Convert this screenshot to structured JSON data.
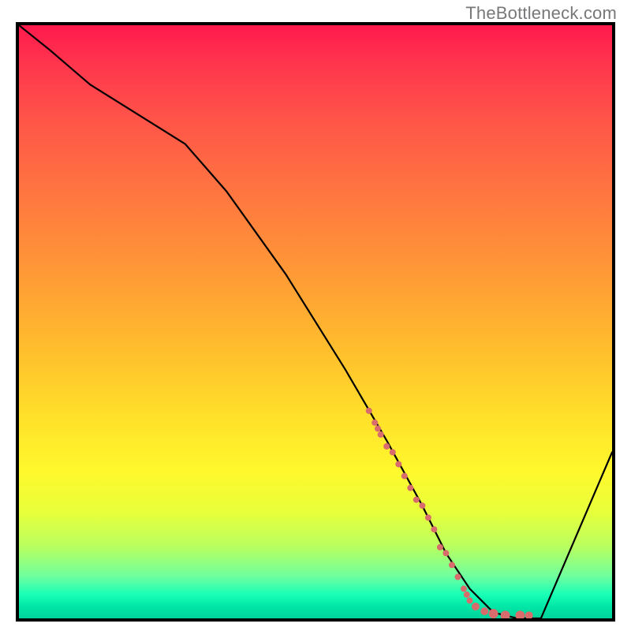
{
  "watermark": "TheBottleneck.com",
  "chart_data": {
    "type": "line",
    "title": "",
    "xlabel": "",
    "ylabel": "",
    "xlim": [
      0,
      100
    ],
    "ylim": [
      0,
      100
    ],
    "gradient_stops": [
      {
        "pos": 0,
        "color": "#ff1a4d"
      },
      {
        "pos": 8,
        "color": "#ff3b4d"
      },
      {
        "pos": 18,
        "color": "#ff5a47"
      },
      {
        "pos": 30,
        "color": "#ff7a3f"
      },
      {
        "pos": 42,
        "color": "#ff9a36"
      },
      {
        "pos": 55,
        "color": "#ffbf2d"
      },
      {
        "pos": 66,
        "color": "#ffe02a"
      },
      {
        "pos": 75,
        "color": "#fff82c"
      },
      {
        "pos": 82,
        "color": "#e8ff3a"
      },
      {
        "pos": 88,
        "color": "#b8ff60"
      },
      {
        "pos": 93,
        "color": "#6dffa0"
      },
      {
        "pos": 96,
        "color": "#18ffb6"
      },
      {
        "pos": 98,
        "color": "#00e7a7"
      },
      {
        "pos": 100,
        "color": "#00d29b"
      }
    ],
    "series": [
      {
        "name": "bottleneck-curve",
        "stroke": "#000000",
        "x": [
          0,
          5,
          12,
          20,
          28,
          35,
          45,
          55,
          62,
          68,
          72,
          76,
          80,
          84,
          88,
          100
        ],
        "values": [
          100,
          96,
          90,
          85,
          80,
          72,
          58,
          42,
          30,
          19,
          11,
          5,
          1,
          0,
          0,
          28
        ]
      }
    ],
    "markers": {
      "name": "highlight-cluster",
      "color": "#d86b6b",
      "x": [
        59,
        60,
        60.5,
        61,
        62,
        63,
        64,
        65,
        66,
        67,
        68,
        69,
        70,
        71,
        72,
        73,
        74,
        75,
        75.5,
        76,
        77,
        78.5,
        80,
        82,
        84.5,
        86
      ],
      "values": [
        35,
        33,
        32,
        31,
        29,
        28,
        26,
        24,
        22,
        20,
        19,
        17,
        15,
        12,
        11,
        9,
        7,
        5,
        4,
        3,
        2,
        1.2,
        0.8,
        0.5,
        0.5,
        0.5
      ],
      "radius": [
        4,
        4,
        4,
        4,
        4,
        4,
        4,
        4,
        4,
        4,
        4,
        4,
        4,
        4,
        4,
        4,
        4,
        4,
        4,
        4,
        5,
        5,
        6,
        6,
        6,
        5
      ]
    }
  }
}
